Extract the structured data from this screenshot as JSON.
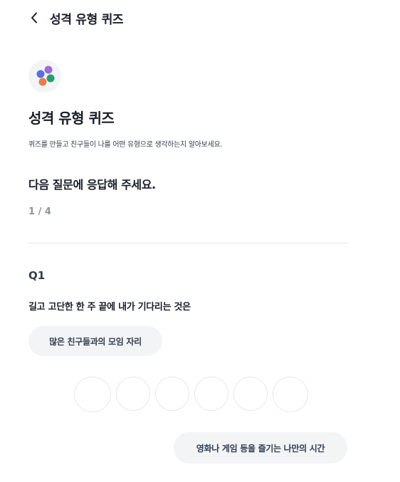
{
  "header": {
    "title": "성격 유형 퀴즈",
    "back_icon": "chevron-left-icon"
  },
  "quiz": {
    "icon": "dots-icon",
    "icon_colors": [
      "#5b6ee1",
      "#9b6bd6",
      "#f07a4a",
      "#22a06b"
    ],
    "title": "성격 유형 퀴즈",
    "description": "퀴즈를 만들고 친구들이 나를 어떤 유형으로 생각하는지 알아보세요."
  },
  "prompt": "다음 질문에 응답해 주세요.",
  "progress": "1 / 4",
  "question": {
    "number": "Q1",
    "text": "길고 고단한 한 주 끝에 내가 기다리는 것은",
    "option_a": "많은 친구들과의 모임 자리",
    "option_b": "영화나 게임 등을 즐기는 나만의 시간",
    "scale_count": 6
  }
}
